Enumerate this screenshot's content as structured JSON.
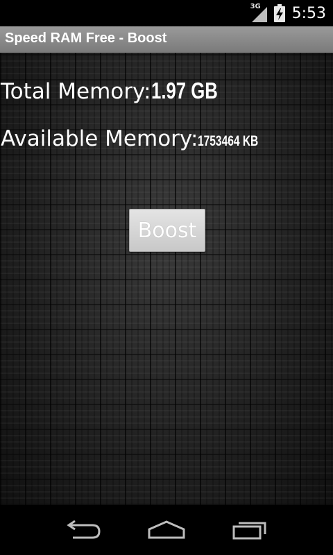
{
  "status_bar": {
    "network_type": "3G",
    "time": "5:53",
    "icons": [
      "signal-icon",
      "battery-charging-icon"
    ]
  },
  "app": {
    "title": "Speed RAM Free - Boost"
  },
  "memory": {
    "total_label": "Total Memory:",
    "total_value": "1.97 GB",
    "available_label": "Available Memory:",
    "available_value": "1753464 KB"
  },
  "actions": {
    "boost_label": "Boost"
  },
  "nav": {
    "icons": [
      "back-icon",
      "home-icon",
      "recent-apps-icon"
    ]
  }
}
